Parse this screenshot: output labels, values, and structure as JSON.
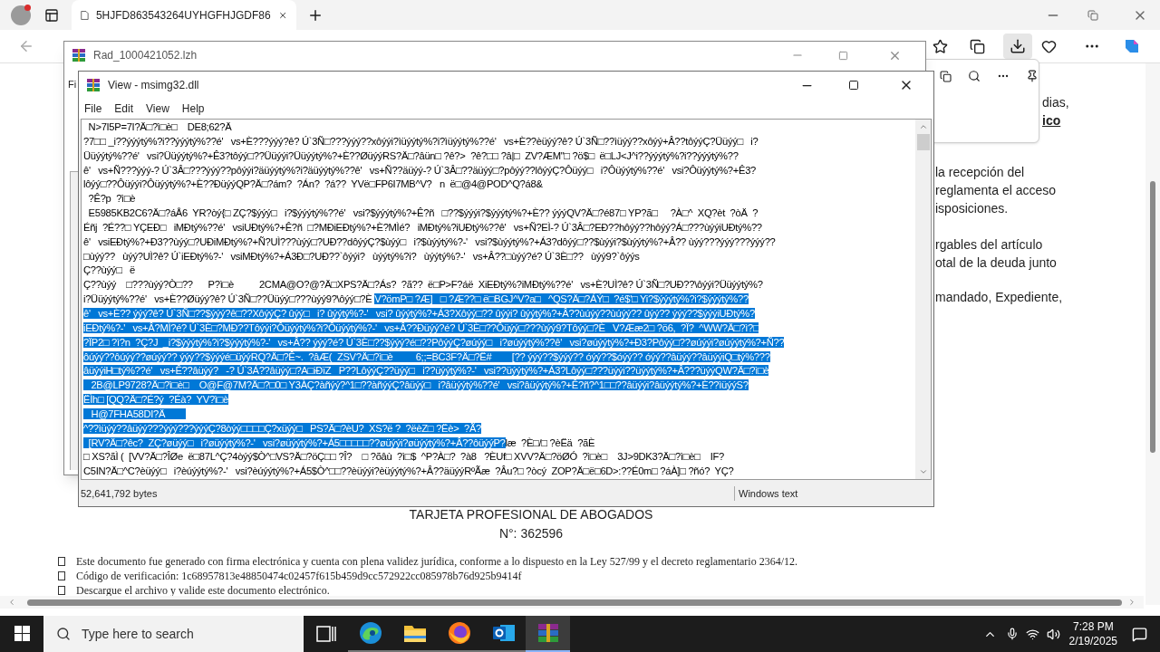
{
  "browser": {
    "tab_title": "5HJFD863543264UYHGFHJGDF86",
    "page_fragments": [
      "la recepción del",
      "reglamenta el acceso",
      "isposiciones.",
      "rgables del artículo",
      "otal de la deuda junto",
      "mandado, Expediente,"
    ],
    "panel_fragments": [
      "dias,",
      "ico"
    ],
    "card_title": "TARJETA PROFESIONAL DE ABOGADOS",
    "card_number": "N°: 362596",
    "bullets": [
      "Este documento fue generado con firma electrónica y cuenta con plena validez jurídica, conforme a lo dispuesto en la Ley 527/99 y el decreto reglamentario 2364/12.",
      "Código de verificación: 1c68957813e48850474c02457f615b459d9cc572922cc085978b76d925b9414f",
      "Descargue el archivo y valide este documento electrónico."
    ]
  },
  "archive_window": {
    "title": "Rad_1000421052.lzh",
    "menu_fragment": "Fi"
  },
  "viewer": {
    "title": "View - msimg32.dll",
    "menu": [
      "File",
      "Edit",
      "View",
      "Help"
    ],
    "lines": [
      {
        "segments": [
          {
            "text": "  N>7I5P=7I?Ä□?ì□è□    DE8;62?Ä",
            "selected": false
          }
        ]
      },
      {
        "segments": [
          {
            "text": "?7□□ _i??ýýýtý%?i??ýýýtý%??é'   vs+È???ýýý?ê? Ú`3Ñ□???ýýý??xôýýi?ìüýýtý%?i?ìüýýtý%??é'   vs+È??èüýý?ê? Ú`3Ñ□??ìüýý??xôýý+Â??tôýýÇ?Üüýý□   i?",
            "selected": false
          }
        ]
      },
      {
        "segments": [
          {
            "text": "Üüýýtý%??é'   vsi?Üüýýtý%?+Ê3?tôýý□??Üüýýi?Üüýýtý%?+È??ØüýýRS?Ä□?âün□ ?ê?>  ?ê?□□ ?â|□  ZV?ÆM\"□ ?ö$□  ë□LJ<J^i??ýýýtý%?i??ýýýtý%??",
            "selected": false
          }
        ]
      },
      {
        "segments": [
          {
            "text": "ê'   vs+Ñ???ýýý-? Ú`3Â□???ýýý??pôýýi?äüýýtý%?i?äüýýtý%??ê'   vs+Ñ??äüýý-? Ú`3Â□??äüýý□?pôýý??lôýýÇ?Ôüýý□   i?Ôüýýtý%??é'   vsi?Ôüýýtý%?+Ê3?",
            "selected": false
          }
        ]
      },
      {
        "segments": [
          {
            "text": "lôýý□??Ôüýýi?Ôüýýtý%?+È??ÐüýýQP?Ä□?ám?  ?Án?  ?á??  YVë□FP6I7MB^V?   n  ë□@4@POD^Q?á8&",
            "selected": false
          }
        ]
      },
      {
        "segments": [
          {
            "text": "  ?Ê?p  ?ì□è",
            "selected": false
          }
        ]
      },
      {
        "segments": [
          {
            "text": "  E5985KB2C6?Ä□?áÅ6  YR?òý{□ ZÇ?$ýýý□   i?$ýýýtý%??é'   vsi?$ýýýtý%?+Ê?ñ   □??$ýýýi?$ýýýtý%?+È?? ýýýQV?Ä□?é87□ YP?ã□     ?À□^  XQ?èt  ?òÄ  ?",
            "selected": false
          }
        ]
      },
      {
        "segments": [
          {
            "text": "Éñj  ?É??□ YÇEÐ□   iMÐtý%??é'   vsiUÐtý%?+Ê?ñ  □?MÐiEÐtý%?+È?MÌé?   iMÐtý%?iUÐtý%??ê'   vs+Ñ?EÌ-? Ú`3Â□?EÐ??hôýý??hôýý?Á□???ùýýiUÐtý%??",
            "selected": false
          }
        ]
      },
      {
        "segments": [
          {
            "text": "ê'   vsiEÐtý%?+Ð3??ùýý□?UÐiMÐtý%?+Ñ?UÌ???ùýý□?UÐ??dôýýÇ?$ùýý□   i?$ùýýtý%?-'   vsi?$ùýýtý%?+Á3?dôýý□??$ùýýi?$ùýýtý%?+Â?? ùýý???ýýý???ýýý??",
            "selected": false
          }
        ]
      },
      {
        "segments": [
          {
            "text": "□ùýý??   ùýý?UÌ?ê? Ú`iEÐtý%?-'   vsiMÐtý%?+Á3Ð□?UÐ??`ôýýi?   ùýýtý%?i?   ùýýtý%?-'   vs+Â??□ùýý?é? Ú`3È□??   ùýý9?`ôýýs",
            "selected": false
          }
        ]
      },
      {
        "segments": [
          {
            "text": "Ç??ùýý□   ë",
            "selected": false
          }
        ]
      },
      {
        "segments": [
          {
            "text": "Ç??ùýý    □???ùýý?Ò□??      P?ì□è          2CMA@O?@?Ä□XPS?Ä□?Ás?  ?ã??  ë□P>F?áë  XiEÐtý%?iMÐtý%??é'   vs+È?UÌ?ê? Ú`3Ñ□?UÐ??\\ôýýi?Üüýýtý%?",
            "selected": false
          }
        ]
      },
      {
        "segments": [
          {
            "text": "i?Üüýýtý%??é'   vs+È??Øüýý?ê? Ú`3Ñ□??Üüýý□???ùýý9?\\ôýý□?È ",
            "selected": false
          },
          {
            "text": "V?ömP□ ?Æ]   □ ?Æ??□ ë□BGJ^V?a□   ^QS?Ä□?ÁÝ□  ?é$'□ Yi?$ýýýtý%?i?$ýýýtý%??",
            "selected": true
          }
        ]
      },
      {
        "segments": [
          {
            "text": "ê'   vs+È?? ýýý?ê? Ú`3Ñ□??$ýýý?ê□??XôýýÇ? ûýý□   i? ûýýtý%?-'   vsi? ûýýtý%?+Á3?Xôýý□?? ûýýi? ûýýtý%?+Â??ùúýý??ùúýý?? ûýý?? ýýý??$ýýýiUÐtý%?",
            "selected": true
          }
        ]
      },
      {
        "segments": [
          {
            "text": "iEÐtý%?-'   vs+Â?MÌ?é? Ú`3È□?MÐ??Tôýýi?Ôüýýtý%?i?Ôüýýtý%?-'   vs+Â??Ðüýý?é? Ú`3È□??Ôüýý□???ùýý9?Tôýý□?È   V?Ææ2□ ?ö6,  ?Ï?  ^WW?Ä□?ì?□",
            "selected": true
          }
        ]
      },
      {
        "segments": [
          {
            "text": "?ÏP2□ ?ì?n  ?Ç?J  _i?$ýýýtý%?i?$ýýýtý%?-'   vs+Â?? ýýý?é? Ú`3È□??$ýýý?é□??PôýýÇ?øúýý□   i?øúýýtý%??ê'   vsi?øúýýtý%?+Ð3?Pôýý□??øúýýi?øúýýtý%?+Ñ??",
            "selected": true
          }
        ]
      },
      {
        "segments": [
          {
            "text": "ôúýý??ôúýý??øúýý?? ýýý??$ýýýé□üýýRQ?Ä□?Ê~.  ?âÆ(  ZSV?Ä□?ì□è         6;;=BC3F?Ä□?Ë#        [?? ýýý??$ýýý?? óýý??$óýý?? óýý??âüýý??âüýýiQ□tý%???",
            "selected": true
          }
        ]
      },
      {
        "segments": [
          {
            "text": "âüýýiH□tý%??é'   vs+Ê??âüýý?   -? Ú`3Á??âüýý□?A□iÐïZ   P??LôýýÇ??üýý□   i??üýýtý%?-'   vsi??üýýtý%?+Á3?Lôýý□???üýýi??üýýtý%?+Â???üýýQW?Ä□?ì□è",
            "selected": true
          }
        ]
      },
      {
        "segments": [
          {
            "text": "   2B@LP9728?Ä□?ì□è□    O@F@7M?Ä□?□0□ Y3ÀÇ?àñýý?^1□??àñýýÇ?âüýý□   i?âüýýtý%??é'   vsi?âüýýtý%?+Ê?ñ?^1□□??âüýýi?âüýýtý%?+È??ìüýýS?",
            "selected": true
          }
        ]
      },
      {
        "segments": [
          {
            "text": "ËÌh□ [QQ?Ä□?É?ý  ?Éà?  YV?ì□è",
            "selected": true
          }
        ]
      },
      {
        "segments": [
          {
            "text": "   H@7FHA58DI?Ä        ",
            "selected": true
          }
        ]
      },
      {
        "segments": [
          {
            "text": "^??ìüýý??âüýý???ýýý???ýýýÇ?8òýý□□□□Ç?xüýý□   PS?Ä□?èU?  XS?ë ?  ?ëèZ□ ?Ëè>  ?Ã?",
            "selected": true
          }
        ]
      },
      {
        "segments": [
          {
            "text": "  [RV?Ä□?êc?  ZÇ?øüýý□   i?øüýýtý%?-'   vsi?øüýýtý%?+Á5□□□□□??øüýýi?øüýýtý%?+Â??ôüýýP?",
            "selected": true
          },
          {
            "text": "læ  ?È□/□ ?èËä  ?ãÈ",
            "selected": false
          }
        ]
      },
      {
        "segments": [
          {
            "text": "□ XS?ãÌ (  [VV?Ä□?ÎØe  ë□87L^Ç?4òýý$Ò^□VS?Ä□?öÇ□□ ?Î?    □ ?õâù  ?ì□$  ^P?À□?  ?à8   ?ÈUf□ XVV?Ä□?öØÓ  ?ì□è□    3J>9DK3?Ä□?ì□è□    IF?",
            "selected": false
          }
        ]
      },
      {
        "segments": [
          {
            "text": "C5IN?Ä□^C?èüýý□   i?èúýýtý%?-'   vsi?èúýýtý%?+Á5$Ò^□□??èüýýi?èüýýtý%?+Â??äüýýRºÃæ  ?Âu?□ ?òcý  ZOP?Ä□ë□6D>:??É0m□ ?áÀ]□ ?ñó?  YÇ?",
            "selected": false
          }
        ]
      }
    ],
    "status": [
      "52,641,792 bytes",
      "Windows text"
    ]
  },
  "taskbar": {
    "search_placeholder": "Type here to search",
    "apps": [
      {
        "kind": "taskview",
        "selected": false
      },
      {
        "kind": "edge",
        "selected": false
      },
      {
        "kind": "explorer",
        "selected": false
      },
      {
        "kind": "firefox",
        "selected": false
      },
      {
        "kind": "outlook",
        "selected": false
      },
      {
        "kind": "winrar",
        "selected": true
      }
    ],
    "time": "7:28 PM",
    "date": "2/19/2025"
  }
}
